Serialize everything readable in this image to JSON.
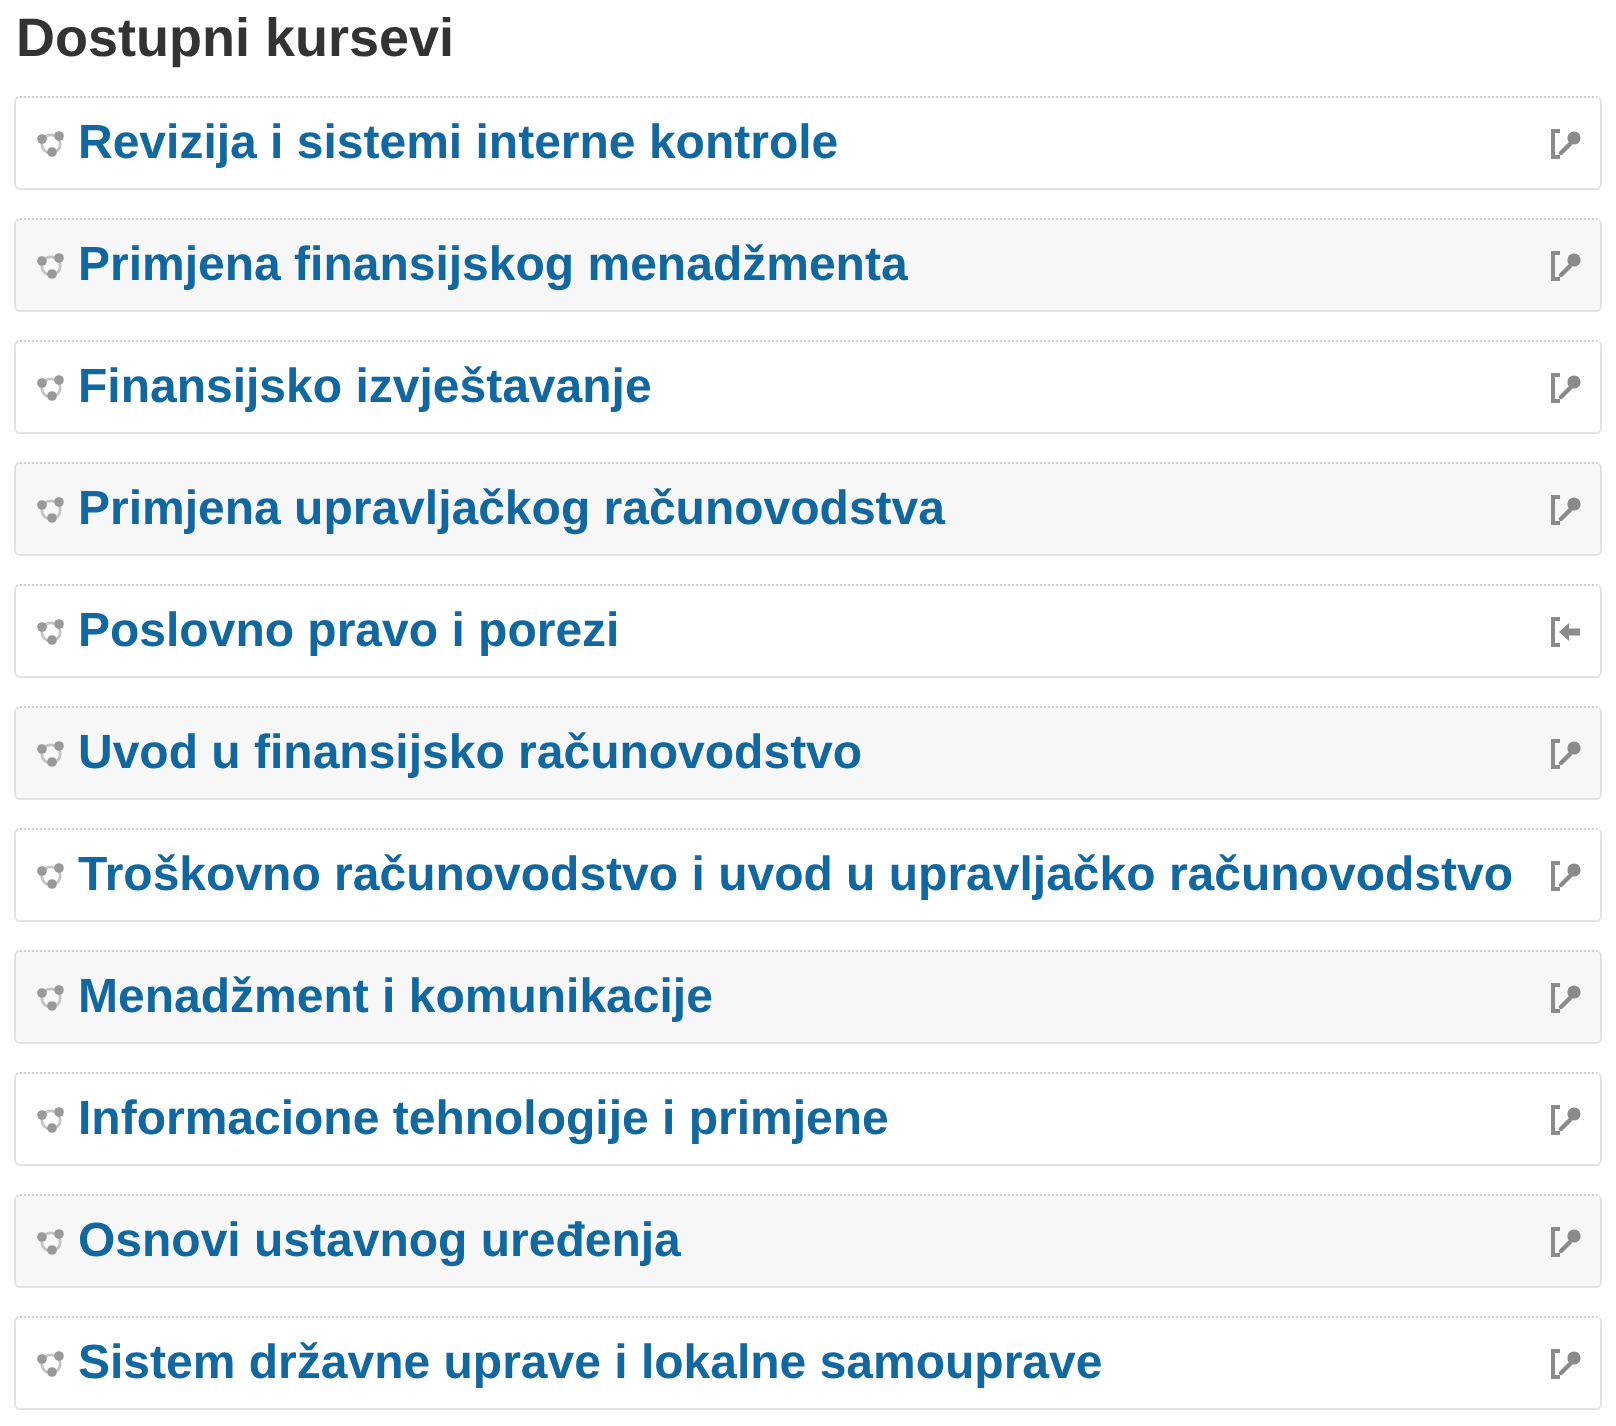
{
  "heading": "Dostupni kursevi",
  "courses": [
    {
      "name": "Revizija i sistemi interne kontrole",
      "kind": "key"
    },
    {
      "name": "Primjena finansijskog menadžmenta",
      "kind": "key"
    },
    {
      "name": "Finansijsko izvještavanje",
      "kind": "key"
    },
    {
      "name": "Primjena upravljačkog računovodstva",
      "kind": "key"
    },
    {
      "name": "Poslovno pravo i porezi",
      "kind": "enter"
    },
    {
      "name": "Uvod u finansijsko računovodstvo",
      "kind": "key"
    },
    {
      "name": "Troškovno računovodstvo i uvod u upravljačko računovodstvo",
      "kind": "key"
    },
    {
      "name": "Menadžment i komunikacije",
      "kind": "key"
    },
    {
      "name": "Informacione tehnologije i primjene",
      "kind": "key"
    },
    {
      "name": "Osnovi ustavnog uređenja",
      "kind": "key"
    },
    {
      "name": "Sistem državne uprave i lokalne samouprave",
      "kind": "key"
    }
  ]
}
